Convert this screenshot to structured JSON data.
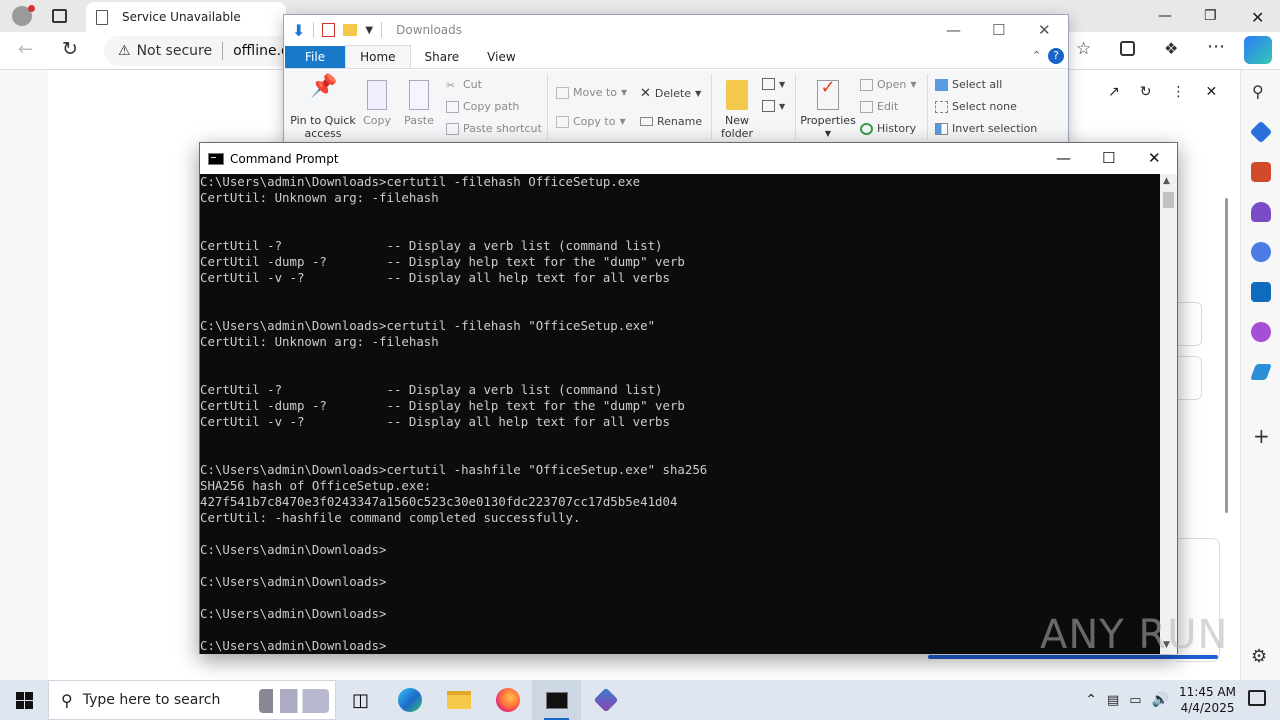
{
  "edge": {
    "tab_title": "Service Unavailable",
    "security_label": "Not secure",
    "address": "offline.of"
  },
  "explorer": {
    "title": "Downloads",
    "tabs": [
      "File",
      "Home",
      "Share",
      "View"
    ],
    "ribbon": {
      "pin_label_1": "Pin to Quick",
      "pin_label_2": "access",
      "copy": "Copy",
      "paste": "Paste",
      "cut": "Cut",
      "copy_path": "Copy path",
      "paste_shortcut": "Paste shortcut",
      "move_to": "Move to",
      "copy_to": "Copy to",
      "delete": "Delete",
      "rename": "Rename",
      "new_folder_1": "New",
      "new_folder_2": "folder",
      "properties": "Properties",
      "open": "Open",
      "edit": "Edit",
      "history": "History",
      "select_all": "Select all",
      "select_none": "Select none",
      "invert_selection": "Invert selection"
    }
  },
  "cmd": {
    "title": "Command Prompt",
    "lines": [
      "C:\\Users\\admin\\Downloads>certutil -filehash OfficeSetup.exe",
      "CertUtil: Unknown arg: -filehash",
      "",
      "",
      "CertUtil -?              -- Display a verb list (command list)",
      "CertUtil -dump -?        -- Display help text for the \"dump\" verb",
      "CertUtil -v -?           -- Display all help text for all verbs",
      "",
      "",
      "C:\\Users\\admin\\Downloads>certutil -filehash \"OfficeSetup.exe\"",
      "CertUtil: Unknown arg: -filehash",
      "",
      "",
      "CertUtil -?              -- Display a verb list (command list)",
      "CertUtil -dump -?        -- Display help text for the \"dump\" verb",
      "CertUtil -v -?           -- Display all help text for all verbs",
      "",
      "",
      "C:\\Users\\admin\\Downloads>certutil -hashfile \"OfficeSetup.exe\" sha256",
      "SHA256 hash of OfficeSetup.exe:",
      "427f541b7c8470e3f0243347a1560c523c30e0130fdc223707cc17d5b5e41d04",
      "CertUtil: -hashfile command completed successfully.",
      "",
      "C:\\Users\\admin\\Downloads>",
      "",
      "C:\\Users\\admin\\Downloads>",
      "",
      "C:\\Users\\admin\\Downloads>",
      "",
      "C:\\Users\\admin\\Downloads>"
    ]
  },
  "watermark": "ANY RUN",
  "taskbar": {
    "search_placeholder": "Type here to search",
    "time": "11:45 AM",
    "date": "4/4/2025"
  }
}
